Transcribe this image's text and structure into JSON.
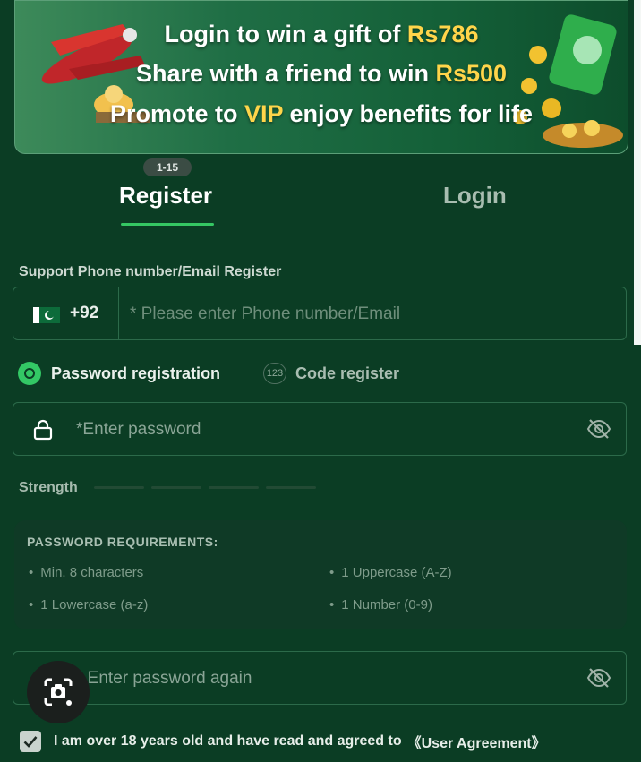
{
  "banner": {
    "line1_text": "Login to win a gift of ",
    "line1_amount": "Rs786",
    "line2_text": "Share with a friend to win ",
    "line2_amount": "Rs500",
    "line3_prefix": "Promote to ",
    "line3_vip": "VIP",
    "line3_suffix": " enjoy benefits for life"
  },
  "tabs": {
    "badge": "1-15",
    "register": "Register",
    "login": "Login"
  },
  "form": {
    "section_label": "Support Phone number/Email Register",
    "country_code": "+92",
    "phone_placeholder": "* Please enter Phone number/Email",
    "option_password": "Password registration",
    "option_code_icon": "123",
    "option_code": "Code register",
    "password_placeholder": "*Enter password",
    "strength_label": "Strength",
    "confirm_placeholder": "* Enter password again"
  },
  "requirements": {
    "title": "PASSWORD REQUIREMENTS:",
    "items": [
      "Min. 8 characters",
      "1 Uppercase (A-Z)",
      "1 Lowercase (a-z)",
      "1 Number (0-9)"
    ]
  },
  "agreement": {
    "text": "I am over 18 years old and have read and agreed to",
    "link": "《User Agreement》",
    "checked": true
  },
  "icons": {
    "lock": "lock-icon",
    "eye": "eye-off-icon",
    "camera": "lens-camera-icon",
    "check": "check-icon"
  },
  "colors": {
    "background": "#0b3d24",
    "accent": "#35c763",
    "gold": "#ffd54a"
  }
}
